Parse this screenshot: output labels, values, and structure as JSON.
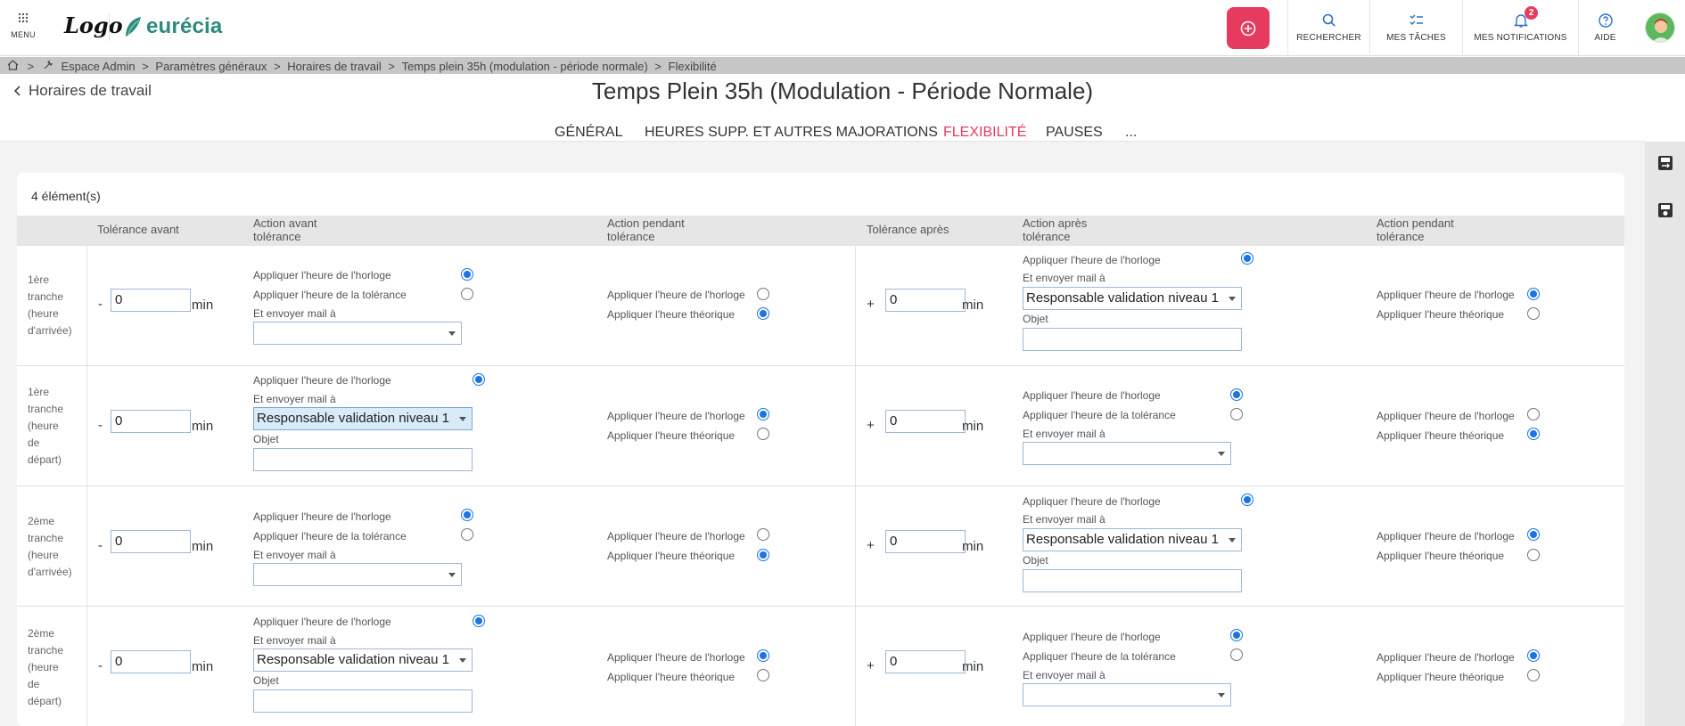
{
  "topbar": {
    "menu_label": "MENU",
    "logo_text": "Logo",
    "brand_name": "eurécia",
    "nav": [
      {
        "label": "RECHERCHER",
        "icon": "search-icon"
      },
      {
        "label": "MES TÂCHES",
        "icon": "tasks-icon"
      },
      {
        "label": "MES NOTIFICATIONS",
        "icon": "bell-icon",
        "badge": "2"
      },
      {
        "label": "AIDE",
        "icon": "help-icon"
      }
    ],
    "accent_color": "#e63a5f"
  },
  "breadcrumb": {
    "sep": ">",
    "items": [
      "Espace Admin",
      "Paramètres généraux",
      "Horaires de travail",
      "Temps plein 35h (modulation - période normale)",
      "Flexibilité"
    ]
  },
  "header": {
    "back_label": "Horaires de travail",
    "title": "Temps Plein 35h (Modulation - Période Normale)",
    "tabs": [
      "GÉNÉRAL",
      "HEURES SUPP. ET AUTRES MAJORATIONS",
      "FLEXIBILITÉ",
      "PAUSES",
      "..."
    ],
    "active_tab": "FLEXIBILITÉ"
  },
  "table": {
    "count": "4 élément(s)",
    "headers": {
      "tol_avant": "Tolérance avant",
      "act_avant_1": "Action avant",
      "act_avant_2": "tolérance",
      "act_pendant_1": "Action pendant",
      "act_pendant_2": "tolérance",
      "tol_apres": "Tolérance après",
      "act_apres_1": "Action après",
      "act_apres_2": "tolérance",
      "act_pendant2_1": "Action pendant",
      "act_pendant2_2": "tolérance"
    },
    "labels": {
      "horloge": "Appliquer l'heure de l'horloge",
      "tolerance": "Appliquer l'heure de la tolérance",
      "theorique": "Appliquer l'heure théorique",
      "mail": "Et envoyer mail à",
      "objet": "Objet",
      "minus": "-",
      "plus": "+",
      "min": "min",
      "responsable": "Responsable validation niveau 1"
    },
    "rows": [
      {
        "l1": "1ère",
        "l2": "tranche",
        "l3": "(heure",
        "l4": "d'arrivée)",
        "l5": "",
        "avant": "0",
        "apres": "0"
      },
      {
        "l1": "1ère",
        "l2": "tranche",
        "l3": "(heure",
        "l4": "de",
        "l5": "départ)",
        "avant": "0",
        "apres": "0"
      },
      {
        "l1": "2ème",
        "l2": "tranche",
        "l3": "(heure",
        "l4": "d'arrivée)",
        "l5": "",
        "avant": "0",
        "apres": "0"
      },
      {
        "l1": "2ème",
        "l2": "tranche",
        "l3": "(heure",
        "l4": "de",
        "l5": "départ)",
        "avant": "0",
        "apres": "0"
      }
    ]
  }
}
